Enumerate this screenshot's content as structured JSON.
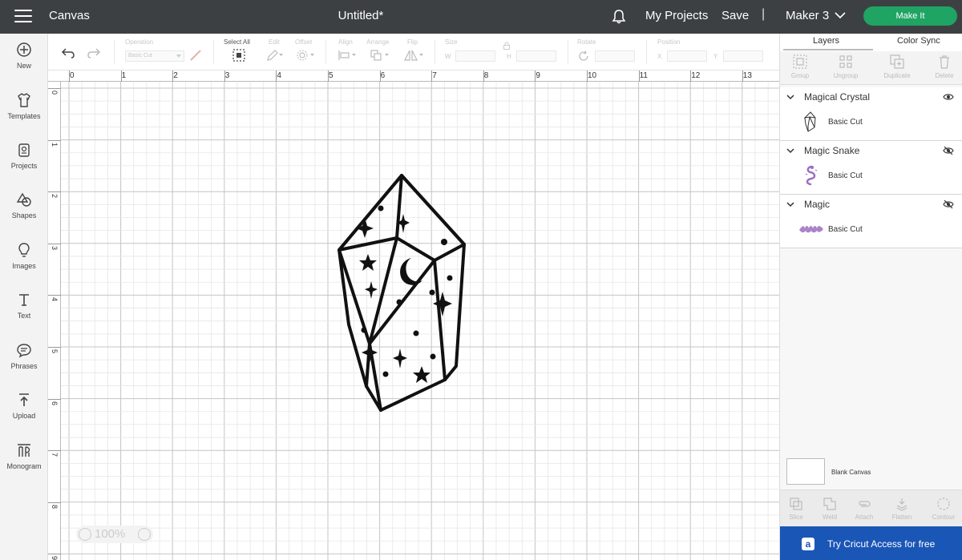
{
  "app": {
    "title": "Canvas",
    "document_title": "Untitled*",
    "my_projects": "My Projects",
    "save": "Save",
    "separator": "|",
    "machine": "Maker 3",
    "make_it": "Make It"
  },
  "sidebar": {
    "items": [
      {
        "label": "New",
        "icon": "plus-circle-icon"
      },
      {
        "label": "Templates",
        "icon": "shirt-icon"
      },
      {
        "label": "Projects",
        "icon": "projects-icon"
      },
      {
        "label": "Shapes",
        "icon": "shapes-icon"
      },
      {
        "label": "Images",
        "icon": "bulb-icon"
      },
      {
        "label": "Text",
        "icon": "text-icon"
      },
      {
        "label": "Phrases",
        "icon": "speech-bubble-icon"
      },
      {
        "label": "Upload",
        "icon": "upload-icon"
      },
      {
        "label": "Monogram",
        "icon": "monogram-icon"
      }
    ]
  },
  "toolbar": {
    "operation_label": "Operation",
    "operation_value": "Basic Cut",
    "select_all": "Select All",
    "edit": "Edit",
    "offset": "Offset",
    "align": "Align",
    "arrange": "Arrange",
    "flip": "Flip",
    "size": "Size",
    "w": "W",
    "h": "H",
    "rotate": "Rotate",
    "position": "Position",
    "x": "X",
    "y": "Y"
  },
  "rulers": {
    "top": [
      "0",
      "1",
      "2",
      "3",
      "4",
      "5",
      "6",
      "7",
      "8",
      "9",
      "10",
      "11",
      "12",
      "13"
    ],
    "left": [
      "0",
      "1",
      "2",
      "3",
      "4",
      "5",
      "6",
      "7",
      "8",
      "9"
    ]
  },
  "zoom": {
    "value": "100%",
    "minus": "−",
    "plus": "+"
  },
  "panel": {
    "tabs": [
      "Layers",
      "Color Sync"
    ],
    "ops": [
      "Group",
      "Ungroup",
      "Duplicate",
      "Delete"
    ],
    "layers": [
      {
        "name": "Magical Crystal",
        "operation": "Basic Cut",
        "visible": true
      },
      {
        "name": "Magic Snake",
        "operation": "Basic Cut",
        "visible": false
      },
      {
        "name": "Magic",
        "operation": "Basic Cut",
        "visible": false
      }
    ],
    "blank_canvas": "Blank Canvas",
    "ops2": [
      "Slice",
      "Weld",
      "Attach",
      "Flatten",
      "Contour"
    ],
    "access": "Try Cricut Access for free",
    "access_icon": "a"
  },
  "colors": {
    "topbar": "#3c4043",
    "make_it": "#1fa463",
    "access": "#1a56b6",
    "purple_thumb": "#9b6fbf"
  }
}
